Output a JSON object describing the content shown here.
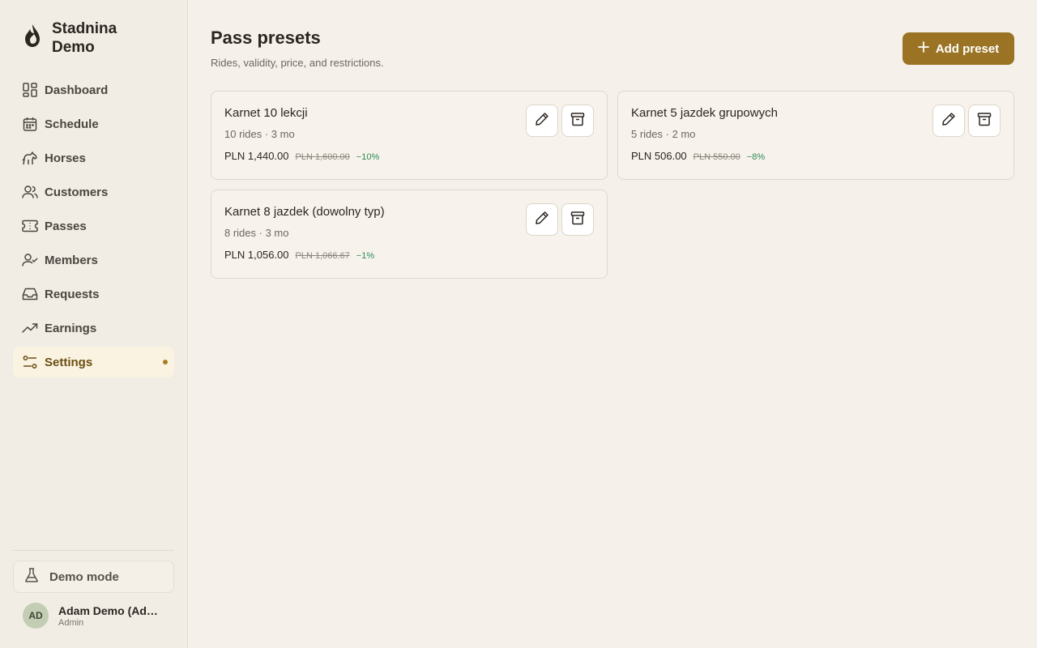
{
  "brand": {
    "name": "Stadnina Demo"
  },
  "nav": [
    {
      "label": "Dashboard",
      "icon": "dashboard-icon"
    },
    {
      "label": "Schedule",
      "icon": "calendar-icon"
    },
    {
      "label": "Horses",
      "icon": "horse-icon"
    },
    {
      "label": "Customers",
      "icon": "users-icon"
    },
    {
      "label": "Passes",
      "icon": "ticket-icon"
    },
    {
      "label": "Members",
      "icon": "user-check-icon"
    },
    {
      "label": "Requests",
      "icon": "inbox-icon"
    },
    {
      "label": "Earnings",
      "icon": "trending-up-icon"
    },
    {
      "label": "Settings",
      "icon": "sliders-icon",
      "active": true
    }
  ],
  "demo_mode": {
    "label": "Demo mode"
  },
  "user": {
    "initials": "AD",
    "name": "Adam Demo (Admin)",
    "role": "Admin"
  },
  "page": {
    "title": "Pass presets",
    "subtitle": "Rides, validity, price, and restrictions.",
    "add_label": "Add preset"
  },
  "presets": [
    {
      "title": "Karnet 10 lekcji",
      "meta": "10 rides · 3 mo",
      "price": "PLN 1,440.00",
      "old_price": "PLN 1,600.00",
      "discount": "−10%"
    },
    {
      "title": "Karnet 5 jazdek grupowych",
      "meta": "5 rides · 2 mo",
      "price": "PLN 506.00",
      "old_price": "PLN 550.00",
      "discount": "−8%"
    },
    {
      "title": "Karnet 8 jazdek (dowolny typ)",
      "meta": "8 rides · 3 mo",
      "price": "PLN 1,056.00",
      "old_price": "PLN 1,066.67",
      "discount": "−1%"
    }
  ],
  "colors": {
    "accent": "#9a7424",
    "background": "#f5f1ea",
    "discount": "#2f8a55"
  }
}
